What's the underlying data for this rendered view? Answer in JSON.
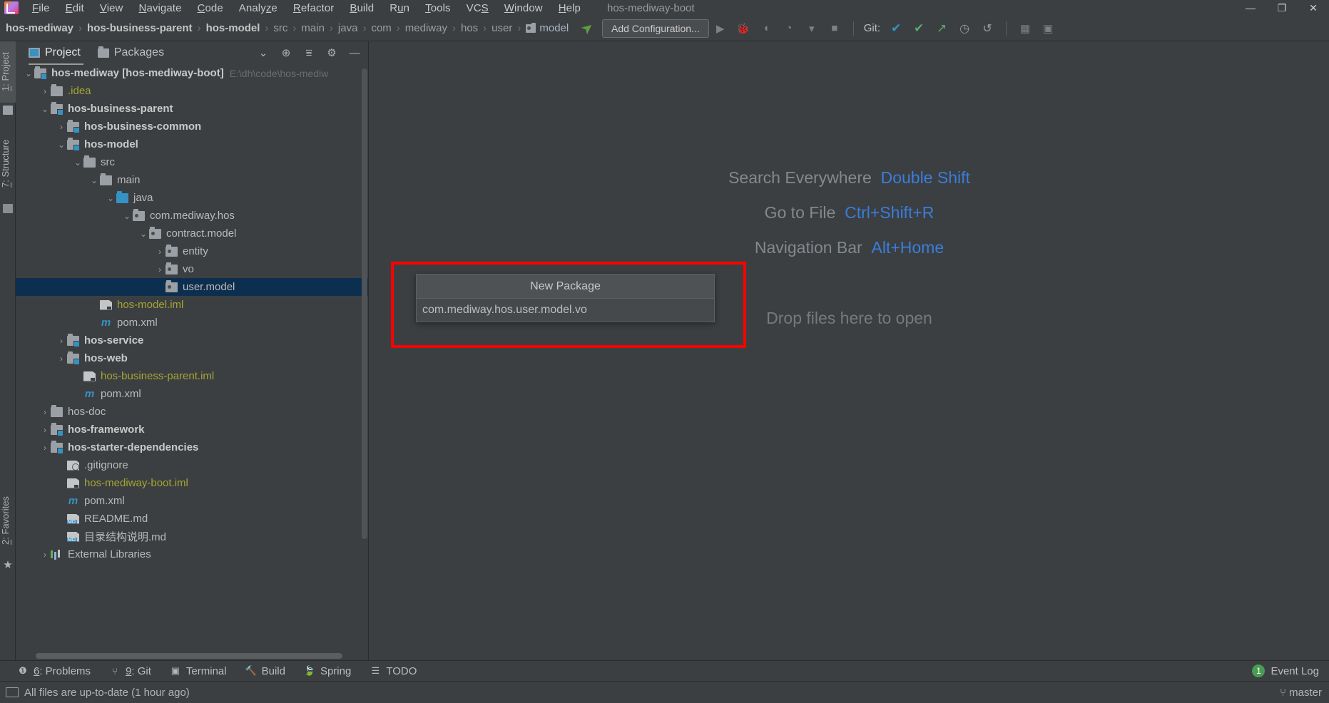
{
  "window": {
    "title": "hos-mediway-boot",
    "controls": {
      "minimize": "—",
      "maximize": "❐",
      "close": "✕"
    }
  },
  "menubar": {
    "items": [
      {
        "label": "File",
        "mnemonic": "F"
      },
      {
        "label": "Edit",
        "mnemonic": "E"
      },
      {
        "label": "View",
        "mnemonic": "V"
      },
      {
        "label": "Navigate",
        "mnemonic": "N"
      },
      {
        "label": "Code",
        "mnemonic": "C"
      },
      {
        "label": "Analyze",
        "mnemonic": "z"
      },
      {
        "label": "Refactor",
        "mnemonic": "R"
      },
      {
        "label": "Build",
        "mnemonic": "B"
      },
      {
        "label": "Run",
        "mnemonic": "u"
      },
      {
        "label": "Tools",
        "mnemonic": "T"
      },
      {
        "label": "VCS",
        "mnemonic": "S"
      },
      {
        "label": "Window",
        "mnemonic": "W"
      },
      {
        "label": "Help",
        "mnemonic": "H"
      }
    ]
  },
  "navbar": {
    "breadcrumbs": [
      {
        "label": "hos-mediway",
        "bold": true
      },
      {
        "label": "hos-business-parent",
        "bold": true
      },
      {
        "label": "hos-model",
        "bold": true
      },
      {
        "label": "src",
        "bold": false
      },
      {
        "label": "main",
        "bold": false
      },
      {
        "label": "java",
        "bold": false
      },
      {
        "label": "com",
        "bold": false
      },
      {
        "label": "mediway",
        "bold": false
      },
      {
        "label": "hos",
        "bold": false
      },
      {
        "label": "user",
        "bold": false
      },
      {
        "label": "model",
        "bold": false,
        "icon": "package-icon"
      }
    ],
    "separator": "›",
    "add_configuration": "Add Configuration...",
    "git_label": "Git:",
    "run_icon": "run-icon",
    "toolbar_icons": [
      "run-icon",
      "debug-icon",
      "run-with-coverage-icon",
      "profiler-icon",
      "dropdown-icon",
      "stop-icon"
    ],
    "git_icons": [
      "update-project-icon",
      "commit-icon",
      "push-icon",
      "history-icon",
      "rollback-icon"
    ],
    "right_icons": [
      "search-everywhere-icon",
      "settings-icon"
    ]
  },
  "stripe": {
    "left_top": [
      {
        "label": "1: Project",
        "mnemonic": "1",
        "active": true
      },
      {
        "label": "7: Structure",
        "mnemonic": "7",
        "active": false
      }
    ],
    "left_bottom": [
      {
        "label": "2: Favorites",
        "mnemonic": "2",
        "active": false
      }
    ]
  },
  "project_panel": {
    "tabs": [
      {
        "label": "Project",
        "icon": "project-icon",
        "active": true
      },
      {
        "label": "Packages",
        "icon": "packages-icon",
        "active": false
      }
    ],
    "actions": [
      "collapse-chevron-icon",
      "locate-icon",
      "collapse-all-icon",
      "settings-icon",
      "hide-icon"
    ],
    "tree": [
      {
        "indent": 0,
        "arrow": "▾",
        "icon": "module",
        "label": "hos-mediway [hos-mediway-boot]",
        "style": "bold",
        "path_hint": "E:\\dh\\code\\hos-mediw"
      },
      {
        "indent": 1,
        "arrow": "▸",
        "icon": "folder",
        "label": ".idea",
        "style": "yellow"
      },
      {
        "indent": 1,
        "arrow": "▾",
        "icon": "module",
        "label": "hos-business-parent",
        "style": "bold"
      },
      {
        "indent": 2,
        "arrow": "▸",
        "icon": "module",
        "label": "hos-business-common",
        "style": "bold"
      },
      {
        "indent": 2,
        "arrow": "▾",
        "icon": "module",
        "label": "hos-model",
        "style": "bold"
      },
      {
        "indent": 3,
        "arrow": "▾",
        "icon": "folder",
        "label": "src",
        "style": "normal"
      },
      {
        "indent": 4,
        "arrow": "▾",
        "icon": "folder",
        "label": "main",
        "style": "normal"
      },
      {
        "indent": 5,
        "arrow": "▾",
        "icon": "folder-src",
        "label": "java",
        "style": "normal"
      },
      {
        "indent": 6,
        "arrow": "▾",
        "icon": "pkg",
        "label": "com.mediway.hos",
        "style": "normal"
      },
      {
        "indent": 7,
        "arrow": "▾",
        "icon": "pkg",
        "label": "contract.model",
        "style": "normal"
      },
      {
        "indent": 8,
        "arrow": "▸",
        "icon": "pkg",
        "label": "entity",
        "style": "normal"
      },
      {
        "indent": 8,
        "arrow": "▸",
        "icon": "pkg",
        "label": "vo",
        "style": "normal"
      },
      {
        "indent": 8,
        "arrow": "",
        "icon": "pkg",
        "label": "user.model",
        "style": "normal",
        "selected": true
      },
      {
        "indent": 4,
        "arrow": "",
        "icon": "iml",
        "label": "hos-model.iml",
        "style": "yellow"
      },
      {
        "indent": 4,
        "arrow": "",
        "icon": "maven",
        "label": "pom.xml",
        "style": "normal"
      },
      {
        "indent": 2,
        "arrow": "▸",
        "icon": "module",
        "label": "hos-service",
        "style": "bold"
      },
      {
        "indent": 2,
        "arrow": "▸",
        "icon": "module",
        "label": "hos-web",
        "style": "bold"
      },
      {
        "indent": 3,
        "arrow": "",
        "icon": "iml",
        "label": "hos-business-parent.iml",
        "style": "yellow"
      },
      {
        "indent": 3,
        "arrow": "",
        "icon": "maven",
        "label": "pom.xml",
        "style": "normal"
      },
      {
        "indent": 1,
        "arrow": "▸",
        "icon": "folder",
        "label": "hos-doc",
        "style": "normal"
      },
      {
        "indent": 1,
        "arrow": "▸",
        "icon": "module",
        "label": "hos-framework",
        "style": "bold"
      },
      {
        "indent": 1,
        "arrow": "▸",
        "icon": "module",
        "label": "hos-starter-dependencies",
        "style": "bold"
      },
      {
        "indent": 2,
        "arrow": "",
        "icon": "gitign",
        "label": ".gitignore",
        "style": "normal"
      },
      {
        "indent": 2,
        "arrow": "",
        "icon": "iml",
        "label": "hos-mediway-boot.iml",
        "style": "yellow"
      },
      {
        "indent": 2,
        "arrow": "",
        "icon": "maven",
        "label": "pom.xml",
        "style": "normal"
      },
      {
        "indent": 2,
        "arrow": "",
        "icon": "md",
        "label": "README.md",
        "style": "normal"
      },
      {
        "indent": 2,
        "arrow": "",
        "icon": "md",
        "label": "目录结构说明.md",
        "style": "normal"
      },
      {
        "indent": 1,
        "arrow": "▸",
        "icon": "extlib",
        "label": "External Libraries",
        "style": "normal"
      }
    ]
  },
  "editor": {
    "hints": [
      {
        "label": "Search Everywhere",
        "key": "Double Shift"
      },
      {
        "label": "Go to File",
        "key": "Ctrl+Shift+R"
      },
      {
        "label": "Navigation Bar",
        "key": "Alt+Home"
      }
    ],
    "drop_text": "Drop files here to open"
  },
  "popup": {
    "title": "New Package",
    "input_value": "com.mediway.hos.user.model.vo",
    "highlight_color": "#ff0000"
  },
  "bottom_toolwindows": [
    {
      "label": "6: Problems",
      "mnemonic": "6",
      "icon": "problems-icon"
    },
    {
      "label": "9: Git",
      "mnemonic": "9",
      "icon": "git-icon"
    },
    {
      "label": "Terminal",
      "mnemonic": "",
      "icon": "terminal-icon"
    },
    {
      "label": "Build",
      "mnemonic": "",
      "icon": "build-icon"
    },
    {
      "label": "Spring",
      "mnemonic": "",
      "icon": "spring-icon"
    },
    {
      "label": "TODO",
      "mnemonic": "",
      "icon": "todo-icon"
    }
  ],
  "event_log": {
    "label": "Event Log",
    "count": "1"
  },
  "status_bar": {
    "message": "All files are up-to-date (1 hour ago)",
    "branch": "master"
  }
}
